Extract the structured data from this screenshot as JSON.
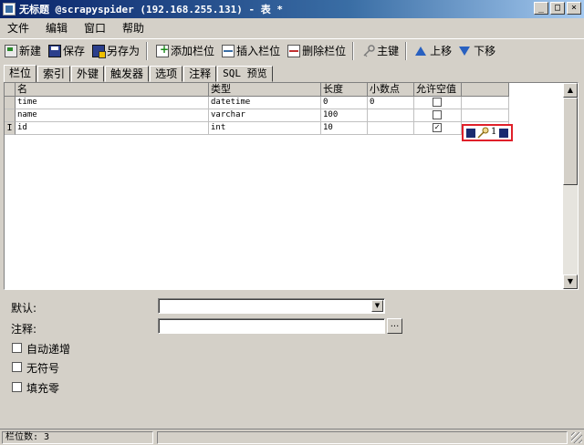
{
  "window": {
    "title": "无标题 @scrapyspider (192.168.255.131) - 表 *",
    "min_label": "_",
    "max_label": "□",
    "close_label": "×"
  },
  "menu": [
    "文件",
    "编辑",
    "窗口",
    "帮助"
  ],
  "toolbar": {
    "new": "新建",
    "save": "保存",
    "save_as": "另存为",
    "add_column": "添加栏位",
    "insert_column": "插入栏位",
    "delete_column": "删除栏位",
    "primary_key": "主键",
    "move_up": "上移",
    "move_down": "下移"
  },
  "tabs": [
    "栏位",
    "索引",
    "外键",
    "触发器",
    "选项",
    "注释",
    "SQL 预览"
  ],
  "active_tab": "栏位",
  "grid": {
    "headers": [
      "名",
      "类型",
      "长度",
      "小数点",
      "允许空值",
      ""
    ],
    "rows": [
      {
        "name": "time",
        "type": "datetime",
        "length": "0",
        "decimals": "0",
        "allow_null": false,
        "key": ""
      },
      {
        "name": "name",
        "type": "varchar",
        "length": "100",
        "decimals": "",
        "allow_null": false,
        "key": ""
      },
      {
        "name": "id",
        "type": "int",
        "length": "10",
        "decimals": "",
        "allow_null": true,
        "key": "1"
      }
    ],
    "current_row_marker": "I"
  },
  "form": {
    "default_label": "默认:",
    "default_value": "",
    "comment_label": "注释:",
    "comment_value": "",
    "comment_btn": "...",
    "auto_increment_label": "自动递增",
    "unsigned_label": "无符号",
    "zerofill_label": "填充零"
  },
  "status": {
    "column_count": "栏位数: 3"
  },
  "colors": {
    "highlight_border": "#e0202a",
    "key_icon_bg": "#1a2b70"
  }
}
